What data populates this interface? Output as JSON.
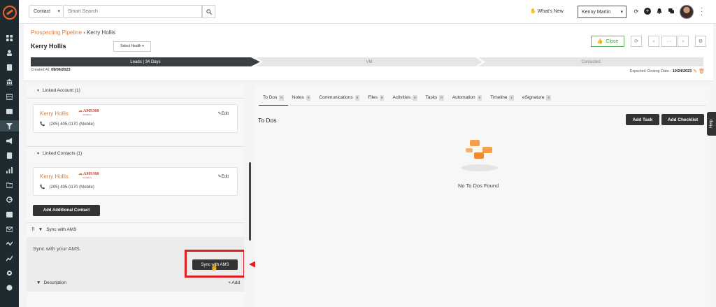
{
  "sidebar": {
    "icons": [
      "dashboard-icon",
      "contacts-icon",
      "documents-icon",
      "institution-icon",
      "table-icon",
      "id-card-icon",
      "pipeline-icon",
      "megaphone-icon",
      "list-icon",
      "chart-icon",
      "folder-icon",
      "g-icon",
      "calendar-icon",
      "mail-icon",
      "activity-icon",
      "analytics-icon",
      "settings-icon",
      "help-circle-icon"
    ]
  },
  "topbar": {
    "entity_select": "Contact",
    "search_placeholder": "Smart Search",
    "whats_new": "What's New",
    "user_select": "Kenny Martin"
  },
  "header": {
    "breadcrumb_link": "Prospecting Pipeline",
    "breadcrumb_sep": "›",
    "breadcrumb_current": "Kerry Hollis",
    "lead_name": "Kerry Hollis",
    "health_label": "Select Health",
    "close_label": "Close",
    "pipeline_stages": [
      "Leads | 34 Days",
      "VM",
      "Contacted"
    ],
    "created_at_label": "Created At:",
    "created_at_value": "09/06/2023",
    "closing_date_label": "Expected Closing Date :",
    "closing_date_value": "10/24/2023"
  },
  "left": {
    "linked_account_title": "Linked Account (1)",
    "linked_contacts_title": "Linked Contacts (1)",
    "account_card": {
      "name": "Kerry Hollis",
      "logo_text": "AMS360",
      "logo_sub": "Vertafore",
      "phone": "(205) 405-0170 (Mobile)",
      "edit": "Edit"
    },
    "contact_card": {
      "name": "Kerry Hollis",
      "logo_text": "AMS360",
      "logo_sub": "Vertafore",
      "phone": "(205) 405-0170 (Mobile)",
      "edit": "Edit"
    },
    "add_contact_label": "Add Additional Contact",
    "sync_title": "Sync with AMS",
    "sync_text": "Sync with your AMS.",
    "sync_button": "Sync with AMS",
    "description_title": "Description",
    "description_add": "+ Add"
  },
  "right": {
    "tabs": [
      {
        "label": "To Dos",
        "count": "0"
      },
      {
        "label": "Notes",
        "count": "0"
      },
      {
        "label": "Communications",
        "count": "0"
      },
      {
        "label": "Files",
        "count": "0"
      },
      {
        "label": "Activities",
        "count": "0"
      },
      {
        "label": "Tasks",
        "count": "0"
      },
      {
        "label": "Automation",
        "count": "0"
      },
      {
        "label": "Timeline",
        "count": "1"
      },
      {
        "label": "eSignature",
        "count": "0"
      }
    ],
    "todos_title": "To Dos",
    "add_task": "Add Task",
    "add_checklist": "Add Checklist",
    "empty_text": "No To Dos Found"
  },
  "help_tab": "Help",
  "colors": {
    "accent": "#e07a3a",
    "annotation": "#e02020",
    "sidebar_bg": "#1f2a30",
    "button_dark": "#333333",
    "success": "#5cb85c"
  }
}
